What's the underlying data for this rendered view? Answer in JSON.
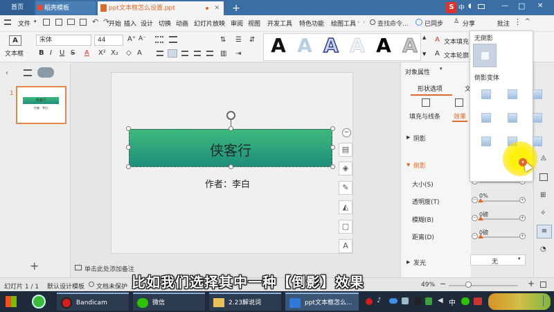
{
  "tabs": {
    "home": "首页",
    "templates": "稻壳模板",
    "document": "ppt文本框怎么设置.ppt",
    "add": "+"
  },
  "title_icons": {
    "wps": "S",
    "lang": "中",
    "min": "—",
    "max": "□",
    "close": "✕"
  },
  "menu": {
    "file": "文件",
    "items": [
      "开始",
      "插入",
      "设计",
      "切换",
      "动画",
      "幻灯片放映",
      "审阅",
      "视图",
      "开发工具",
      "特色功能",
      "绘图工具"
    ],
    "search": "查找命令...",
    "sync": "已同步",
    "share": "分享",
    "comment": "批注"
  },
  "ribbon": {
    "textbox": "文本框",
    "font": "宋体",
    "size": "44",
    "fill": "文本填充",
    "outline": "文本轮廓"
  },
  "thumbnail": {
    "number": "1",
    "title": "侠客行",
    "sub": "作者：李白"
  },
  "slide": {
    "title": "侠客行",
    "author": "作者：李白"
  },
  "notes": "单击此处添加备注",
  "properties": {
    "header": "对象属性",
    "tab_shape": "形状选项",
    "tab_text": "文",
    "sub_fill": "填充与线条",
    "sub_effect": "效果",
    "sec_shadow": "阴影",
    "sec_reflection": "倒影",
    "reflection_value": "无",
    "size_label": "大小(S)",
    "size_value": "0%",
    "transparency_label": "透明度(T)",
    "transparency_value": "0%",
    "blur_label": "模糊(B)",
    "blur_value": "0磅",
    "distance_label": "距离(D)",
    "distance_value": "0磅",
    "glow_label": "发光",
    "glow_value": "无"
  },
  "shadow_menu": {
    "none_label": "无倒影",
    "variants_label": "倒影变体"
  },
  "status": {
    "slide": "幻灯片 1 / 1",
    "theme": "默认设计模板",
    "backup": "文档未保护",
    "zoom": "49%"
  },
  "subtitle": "比如我们选择其中一种【倒影】效果",
  "taskbar": {
    "items": [
      "Bandicam",
      "微信",
      "2.23解说词",
      "ppt文本框怎么..."
    ],
    "lang": "中"
  },
  "colors": {
    "accent": "#e06a2c",
    "titlebar": "#3a6ea5",
    "green_top": "#3dba7c",
    "green_bottom": "#1f8d7b",
    "highlight": "#f2e600"
  }
}
